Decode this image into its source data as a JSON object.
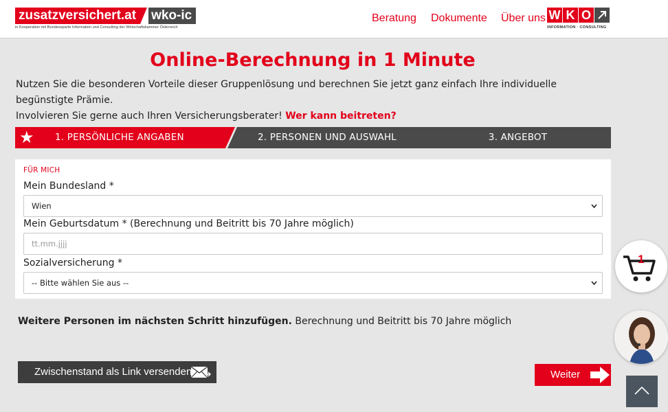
{
  "header": {
    "logo_main": "zusatzversichert.at",
    "logo_secondary": "wko-ic",
    "logo_subline": "in Kooperation mit Bundessparte Information und Consulting der Wirtschaftskammer Österreich",
    "nav": [
      "Beratung",
      "Dokumente",
      "Über uns"
    ],
    "wko_letters": [
      "W",
      "K",
      "O"
    ],
    "wko_subline": "INFORMATION · CONSULTING"
  },
  "title": "Online-Berechnung in 1 Minute",
  "intro": {
    "text_line1": "Nutzen Sie die besonderen Vorteile dieser Gruppenlösung und berechnen Sie jetzt ganz einfach Ihre individuelle begünstigte Prämie.",
    "text_line2": "Involvieren Sie gerne auch Ihren Versicherungsberater!",
    "link": "Wer kann beitreten?"
  },
  "steps": [
    {
      "label": "1.  PERSÖNLICHE ANGABEN",
      "active": true
    },
    {
      "label": "2.  PERSONEN UND AUSWAHL",
      "active": false
    },
    {
      "label": "3.  ANGEBOT",
      "active": false
    }
  ],
  "form": {
    "section": "FÜR MICH",
    "state_label": "Mein Bundesland *",
    "state_value": "Wien",
    "birth_label": "Mein Geburtsdatum * (Berechnung und Beitritt bis 70 Jahre möglich)",
    "birth_placeholder": "tt.mm.jjjj",
    "insurance_label": "Sozialversicherung *",
    "insurance_value": "-- Bitte wählen Sie aus --"
  },
  "note": {
    "bold": "Weitere Personen im nächsten Schritt hinzufügen.",
    "rest": " Berechnung und Beitritt bis 70 Jahre möglich"
  },
  "buttons": {
    "share": "Zwischenstand als Link versenden",
    "next": "Weiter"
  },
  "cart": {
    "count": "1"
  },
  "colors": {
    "accent": "#e2001a",
    "dark": "#4a4a4a",
    "background": "#e6e6e6"
  }
}
